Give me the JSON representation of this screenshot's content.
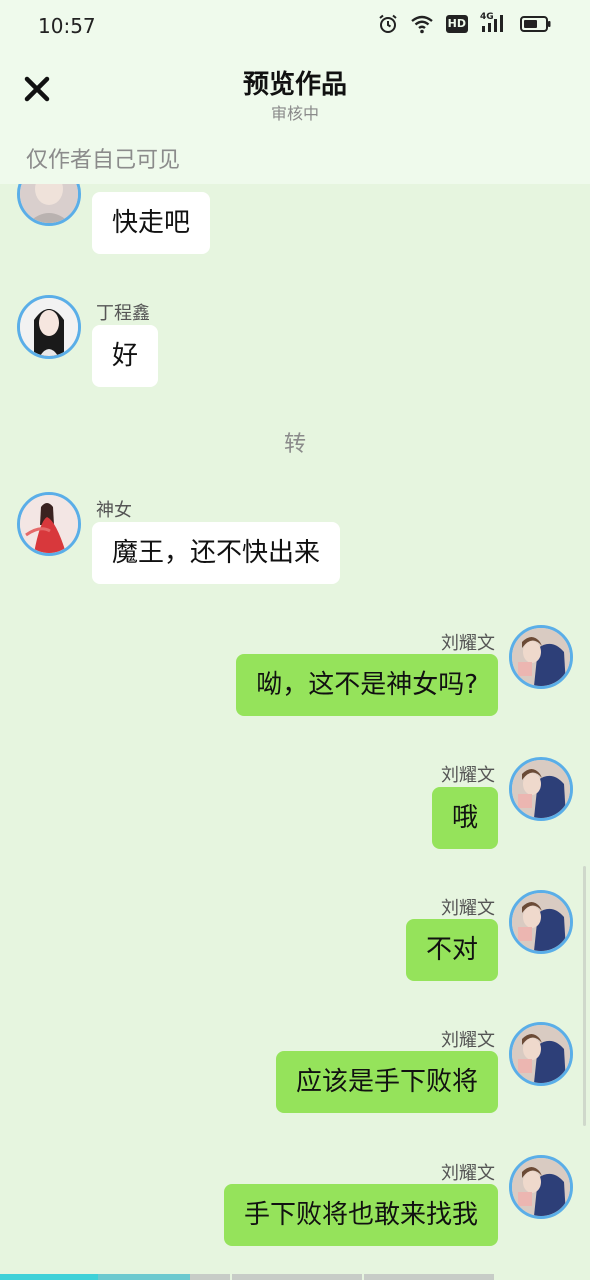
{
  "status_bar": {
    "time": "10:57",
    "icons": [
      "alarm-icon",
      "wifi-icon",
      "hd-icon",
      "4g-signal-icon",
      "battery-icon"
    ],
    "hd_label": "HD",
    "network_label": "4G"
  },
  "header": {
    "close_icon": "close-icon",
    "title": "预览作品",
    "subtitle": "审核中",
    "visibility_note": "仅作者自己可见"
  },
  "messages": [
    {
      "side": "left",
      "sender": "",
      "text": "快走吧"
    },
    {
      "side": "left",
      "sender": "丁程鑫",
      "text": "好"
    },
    {
      "side": "left",
      "sender": "神女",
      "text": "魔王，还不快出来"
    },
    {
      "side": "right",
      "sender": "刘耀文",
      "text": "呦，这不是神女吗?"
    },
    {
      "side": "right",
      "sender": "刘耀文",
      "text": "哦"
    },
    {
      "side": "right",
      "sender": "刘耀文",
      "text": "不对"
    },
    {
      "side": "right",
      "sender": "刘耀文",
      "text": "应该是手下败将"
    },
    {
      "side": "right",
      "sender": "刘耀文",
      "text": "手下败将也敢来找我"
    }
  ],
  "separator": {
    "text": "转"
  },
  "colors": {
    "background": "#e6f5df",
    "header_bg": "#effaec",
    "left_bubble": "#ffffff",
    "right_bubble": "#95e35b",
    "avatar_border": "#5aaee8"
  }
}
